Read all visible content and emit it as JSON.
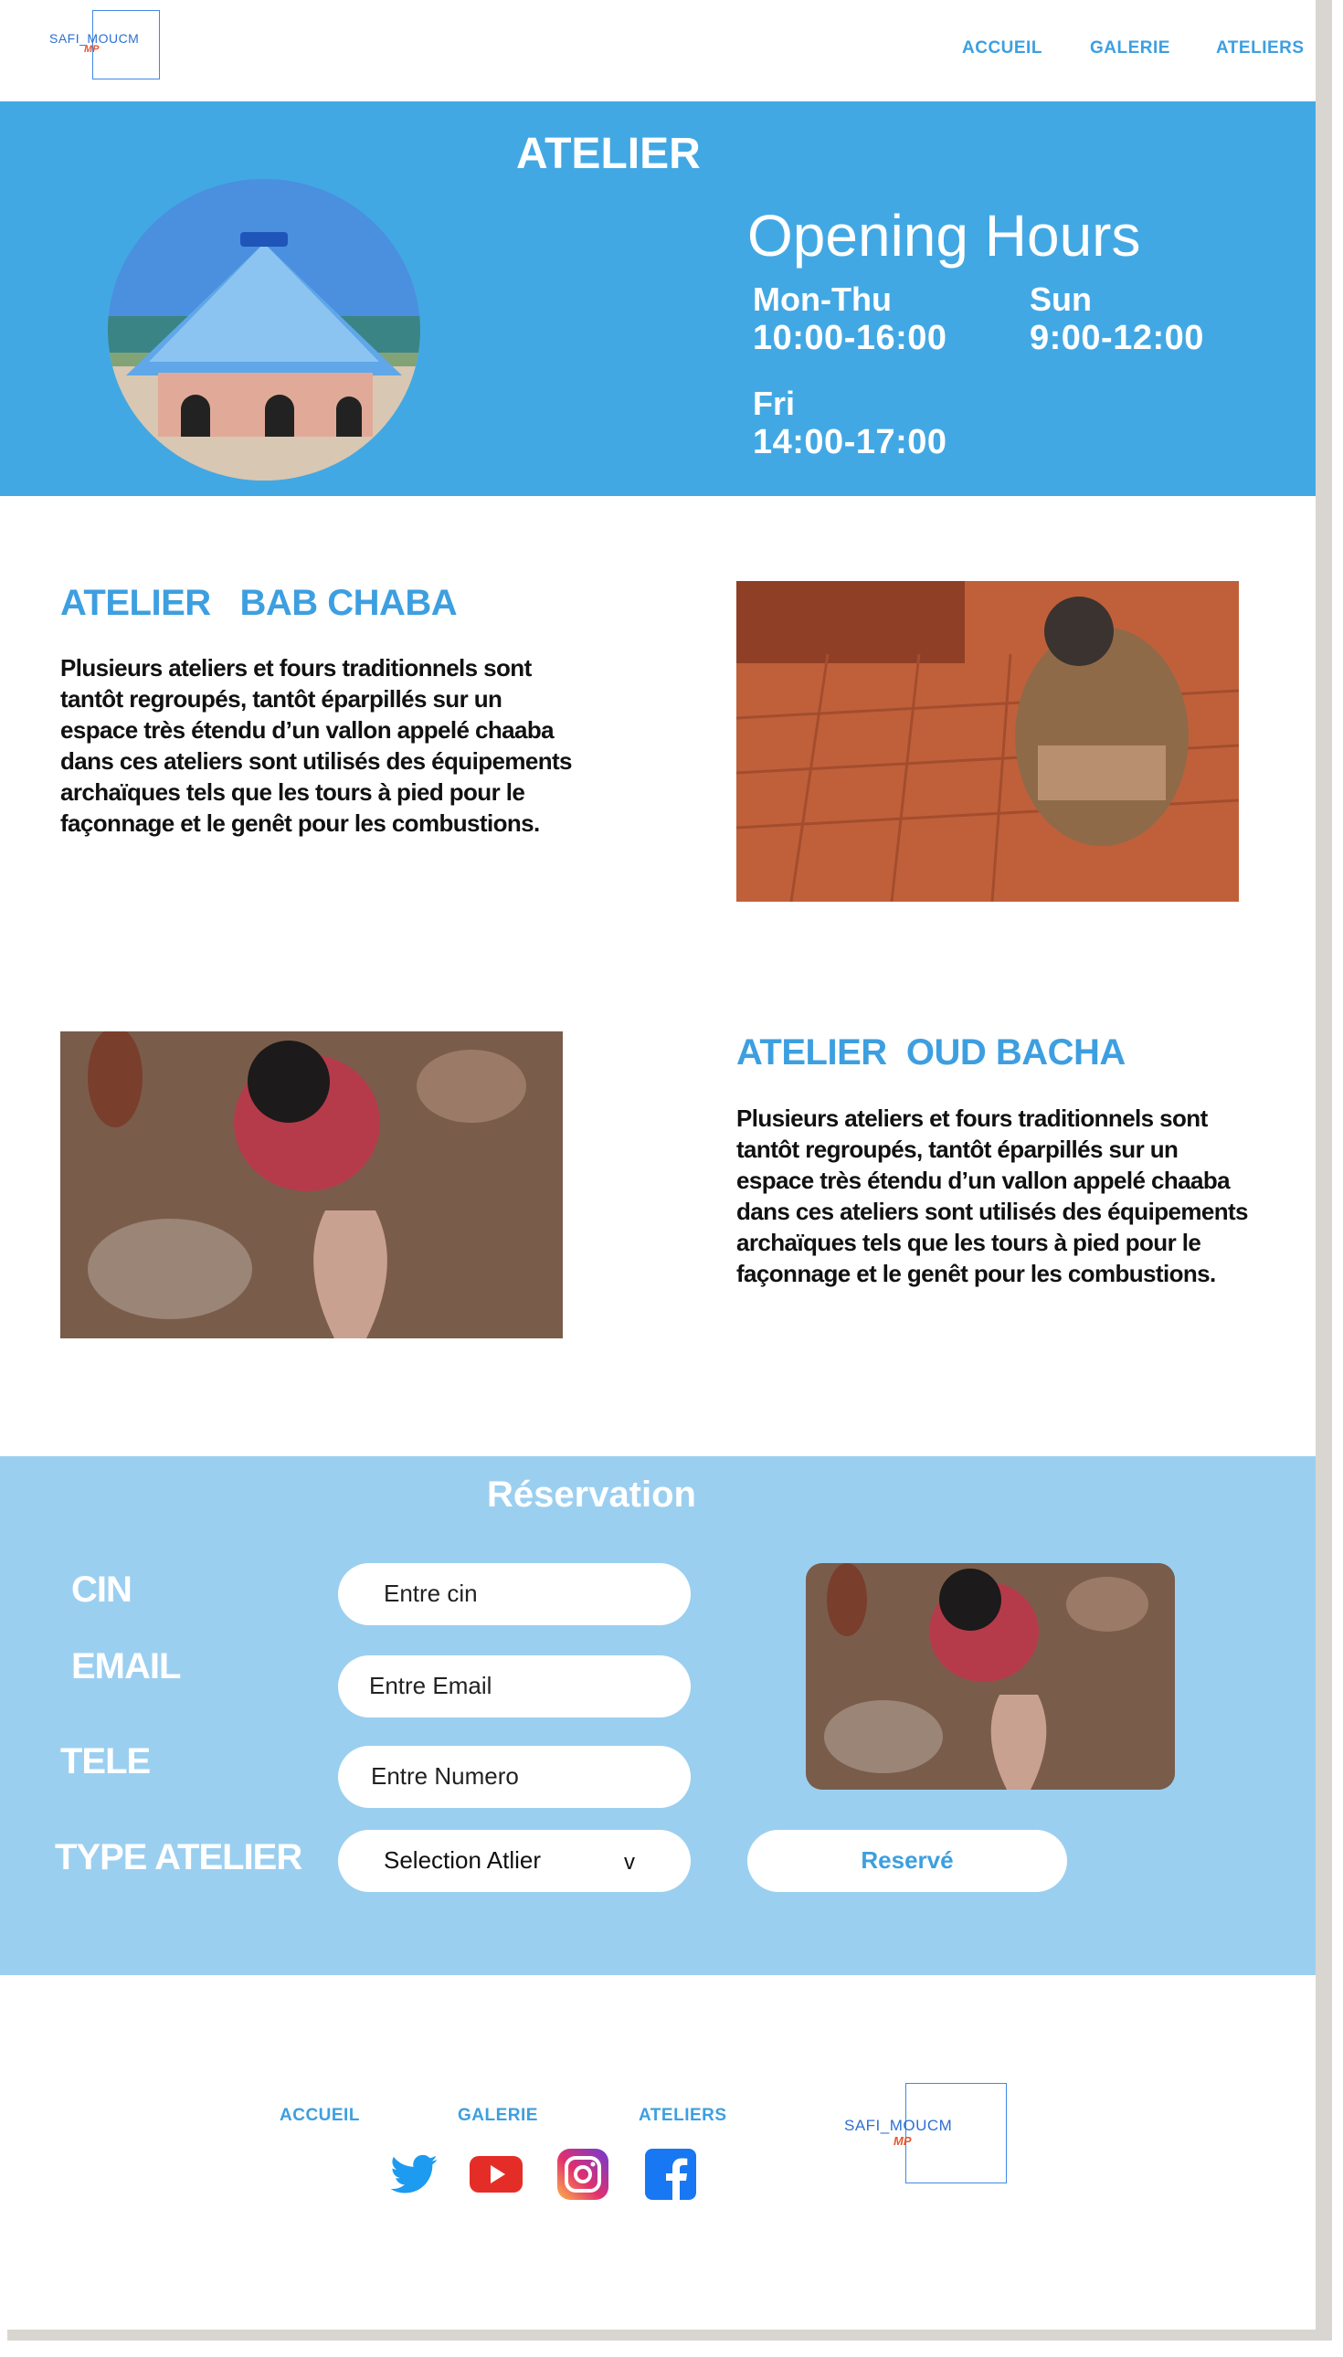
{
  "header": {
    "logo": {
      "text": "SAFI_MOUCM",
      "sub": "MP"
    },
    "nav": {
      "accueil": "ACCUEIL",
      "galerie": "GALERIE",
      "ateliers": "ATELIERS"
    }
  },
  "hero": {
    "title": "ATELIER",
    "opening": {
      "title": "Opening Hours",
      "mon_thu": {
        "day": "Mon-Thu",
        "time": "10:00-16:00"
      },
      "sun": {
        "day": "Sun",
        "time": "9:00-12:00"
      },
      "fri": {
        "day": "Fri",
        "time": "14:00-17:00"
      }
    }
  },
  "ateliers": [
    {
      "title": "ATELIER   BAB CHABA",
      "text": "Plusieurs ateliers et fours traditionnels sont tantôt regroupés, tantôt éparpillés sur un espace très étendu d’un vallon appelé chaaba dans ces ateliers sont utilisés des équipements archaïques tels que les tours à pied pour le façonnage et le genêt pour les combustions."
    },
    {
      "title": "ATELIER  OUD BACHA",
      "text": "Plusieurs ateliers et fours traditionnels sont tantôt regroupés, tantôt éparpillés sur un espace très étendu d’un vallon appelé chaaba dans ces ateliers sont utilisés des équipements archaïques tels que les tours à pied pour le façonnage et le genêt pour les combustions."
    }
  ],
  "reservation": {
    "title": "Réservation",
    "labels": {
      "cin": "CIN",
      "email": "EMAIL",
      "tele": "TELE",
      "type": "TYPE ATELIER"
    },
    "placeholders": {
      "cin": "Entre cin",
      "email": "Entre Email",
      "tele": "Entre Numero"
    },
    "select": {
      "value": "Selection Atlier",
      "arrow": "v"
    },
    "button": "Reservé"
  },
  "footer": {
    "nav": {
      "accueil": "ACCUEIL",
      "galerie": "GALERIE",
      "ateliers": "ATELIERS"
    },
    "social": [
      "twitter-icon",
      "youtube-icon",
      "instagram-icon",
      "facebook-icon"
    ],
    "logo": {
      "text": "SAFI_MOUCM",
      "sub": "MP"
    }
  },
  "colors": {
    "primary_blue": "#42a8e4",
    "light_blue": "#9bcff0",
    "accent_text": "#3d9fe0"
  }
}
